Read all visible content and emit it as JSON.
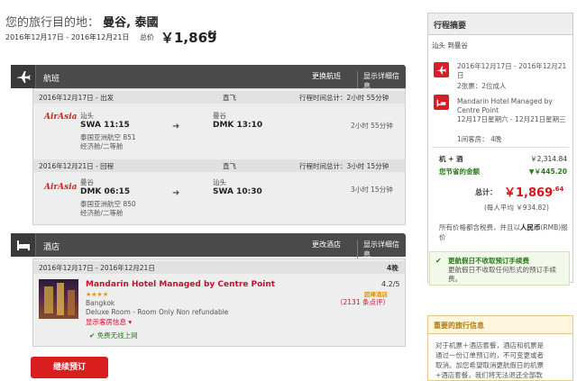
{
  "header": {
    "title_prefix": "您的旅行目的地：",
    "destination": "曼谷, 泰國",
    "dates": "2016年12月17日 - 2016年12月21日",
    "total_label": "总价",
    "total_price": "￥1,869",
    "total_price_decimal": ".64"
  },
  "flight_section": {
    "title": "航班",
    "change_label": "更换航班",
    "details_label": "显示详细信息",
    "outbound": {
      "date_label": "2016年12月17日 - 出发",
      "type": "直飞",
      "total_time": "行程时间总计：2小时 55分钟",
      "airline_logo": "AirAsia",
      "from_city": "汕头",
      "from_code_time": "SWA 11:15",
      "to_city": "曼谷",
      "to_code_time": "DMK 13:10",
      "flight_number": "泰国亚洲航空 851",
      "cabin": "经济舱/二等舱",
      "duration": "2小时 55分钟"
    },
    "return": {
      "date_label": "2016年12月21日 - 回程",
      "type": "直飞",
      "total_time": "行程时间总计：3小时 15分钟",
      "airline_logo": "AirAsia",
      "from_city": "曼谷",
      "from_code_time": "DMK 06:15",
      "to_city": "汕头",
      "to_code_time": "SWA 10:30",
      "flight_number": "泰国亚洲航空 850",
      "cabin": "经济舱/二等舱",
      "duration": "3小时 15分钟"
    }
  },
  "hotel_section": {
    "title": "酒店",
    "change_label": "更改酒店",
    "details_label": "显示详细信息",
    "dates": "2016年12月17日 - 2016年12月21日",
    "nights": "4晚",
    "name": "Mandarin Hotel Managed by Centre Point",
    "stars": "★★★★",
    "city": "Bangkok",
    "room": "Deluxe Room - Room Only Non refundable",
    "show_room_info": "显示客房信息",
    "wifi": "免费无线上网",
    "rating": "4.2/5",
    "rating_badge": "超棒酒店",
    "reviews": "（2131 条点评）"
  },
  "continue_button": "继续预订",
  "summary": {
    "title": "行程摘要",
    "route": "汕头 到曼谷",
    "flight_dates": "2016年12月17日 - 2016年12月21日",
    "travellers": "2张票：2位成人",
    "hotel_name": "Mandarin Hotel Managed by Centre Point",
    "hotel_dates": "12月17日星期六 - 12月21日星期三",
    "rooms": "1间客房： 4晚",
    "package_label": "机 + 酒",
    "package_price": "￥2,314.84",
    "savings_label": "您节省的金额",
    "savings_value": "▼￥445.20",
    "total_label": "总计：",
    "total_price": "￥1,869",
    "total_price_decimal": ".64",
    "per_person": "(每人平均 ￥934.82)",
    "tax_note_1": "所有价格都含税费，并且以",
    "tax_note_currency": "人民币",
    "tax_note_2": "(RMB)报价"
  },
  "notice": {
    "title": "更航假日不收取预订手续费",
    "body": "更航假日不收取任何形式的预订手续费。"
  },
  "info": {
    "title": "重要的旅行信息",
    "body_1": "对于机票＋酒店套餐，酒店和机票是",
    "body_2": "通过一份订单预订的，不可变更或者",
    "body_3": "取消。加您希望取消更航假日的机票",
    "body_4": "+酒店套餐，我们将无法退还全部款"
  },
  "colors": {
    "accent_red": "#d81e1e",
    "bar_dark": "#4a4a4a",
    "saving_green": "#2a7a1a"
  }
}
